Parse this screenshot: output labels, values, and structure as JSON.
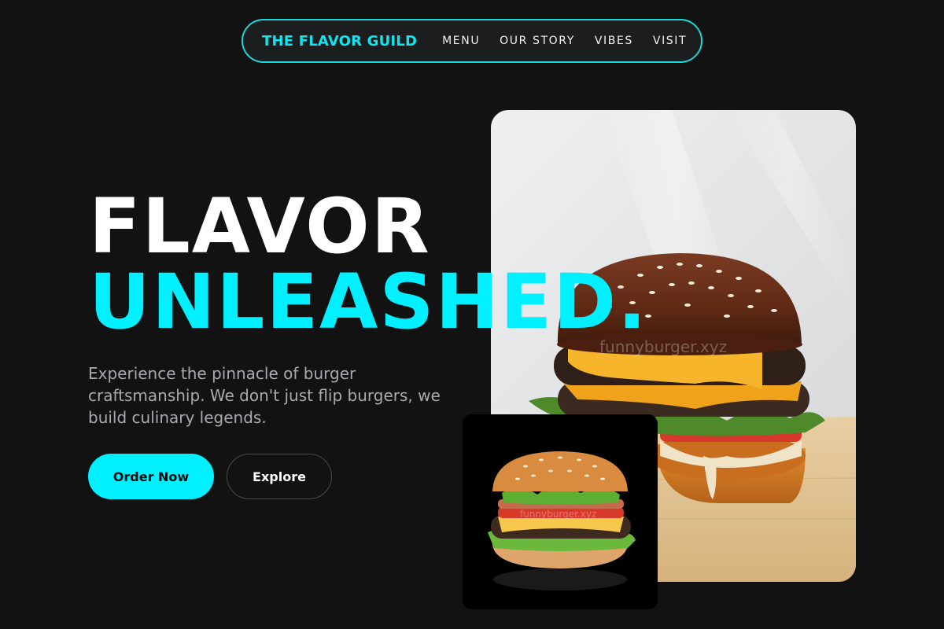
{
  "nav": {
    "brand": "THE FLAVOR GUILD",
    "links": [
      "MENU",
      "OUR STORY",
      "VIBES",
      "VISIT"
    ]
  },
  "hero": {
    "headline_line1": "FLAVOR",
    "headline_line2": "UNLEASHED.",
    "subtext": "Experience the pinnacle of burger craftsmanship. We don't just flip burgers, we build culinary legends.",
    "primary_button": "Order Now",
    "secondary_button": "Explore"
  },
  "images": {
    "main_watermark": "funnyburger.xyz",
    "sub_watermark": "funnyburger.xyz"
  },
  "colors": {
    "accent": "#00f0ff",
    "background": "#121212",
    "nav_border": "#1fd6da"
  }
}
